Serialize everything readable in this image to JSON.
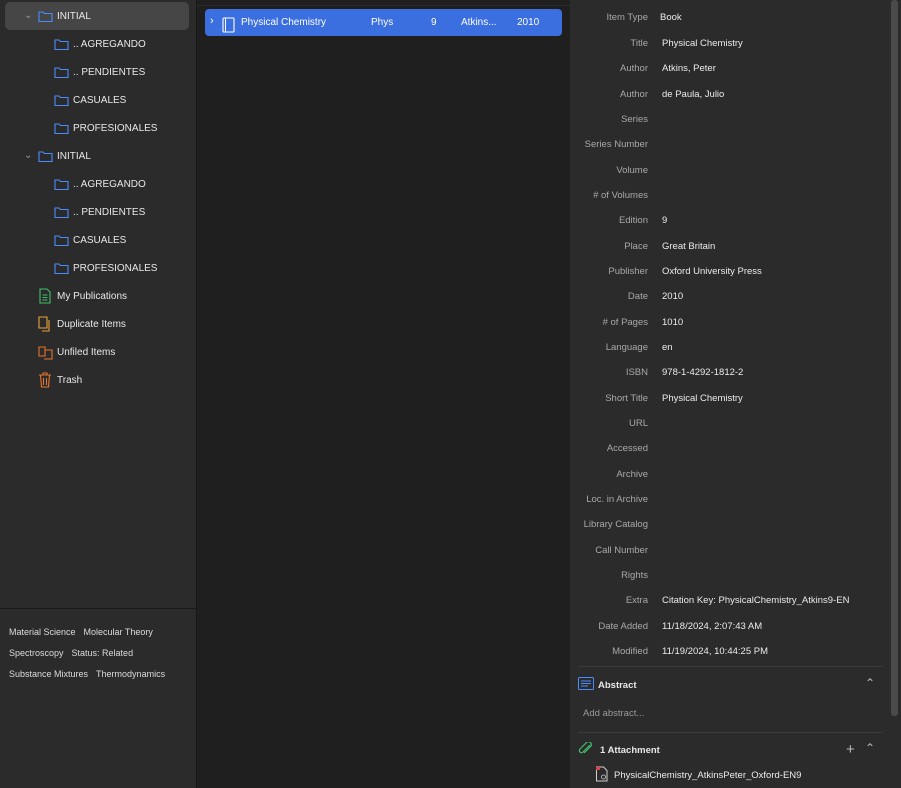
{
  "collections": {
    "items": [
      {
        "label": "INITIAL"
      },
      {
        "label": "..  AGREGANDO"
      },
      {
        "label": "..  PENDIENTES"
      },
      {
        "label": "CASUALES"
      },
      {
        "label": "PROFESIONALES"
      },
      {
        "label": "INITIAL"
      },
      {
        "label": "..  AGREGANDO"
      },
      {
        "label": "..  PENDIENTES"
      },
      {
        "label": "CASUALES"
      },
      {
        "label": "PROFESIONALES"
      },
      {
        "label": "My  Publications"
      },
      {
        "label": "Duplicate  Items"
      },
      {
        "label": "Unfiled  Items"
      },
      {
        "label": "Trash"
      }
    ]
  },
  "tags": [
    "Material  Science",
    "Molecular  Theory",
    "Spectroscopy",
    "Status:  Related",
    "Substance  Mixtures",
    "Thermodynamics"
  ],
  "item_row": {
    "title": "Physical  Chemistry",
    "short": "Phys",
    "edition": "9",
    "creator": "Atkins...",
    "year": "2010"
  },
  "info": {
    "fields": [
      {
        "label": "Item  Type",
        "value": "Book"
      },
      {
        "label": "Title",
        "value": "Physical  Chemistry"
      },
      {
        "label": "Author",
        "value": "Atkins,  Peter"
      },
      {
        "label": "Author",
        "value": "de  Paula,  Julio"
      },
      {
        "label": "Series",
        "value": ""
      },
      {
        "label": "Series  Number",
        "value": ""
      },
      {
        "label": "Volume",
        "value": ""
      },
      {
        "label": "#  of  Volumes",
        "value": ""
      },
      {
        "label": "Edition",
        "value": "9"
      },
      {
        "label": "Place",
        "value": "Great  Britain"
      },
      {
        "label": "Publisher",
        "value": "Oxford  University  Press"
      },
      {
        "label": "Date",
        "value": "2010"
      },
      {
        "label": "#  of  Pages",
        "value": "1010"
      },
      {
        "label": "Language",
        "value": "en"
      },
      {
        "label": "ISBN",
        "value": "978-1-4292-1812-2"
      },
      {
        "label": "Short  Title",
        "value": "Physical  Chemistry"
      },
      {
        "label": "URL",
        "value": ""
      },
      {
        "label": "Accessed",
        "value": ""
      },
      {
        "label": "Archive",
        "value": ""
      },
      {
        "label": "Loc.  in  Archive",
        "value": ""
      },
      {
        "label": "Library  Catalog",
        "value": ""
      },
      {
        "label": "Call  Number",
        "value": ""
      },
      {
        "label": "Rights",
        "value": ""
      },
      {
        "label": "Extra",
        "value": "Citation  Key:  PhysicalChemistry_Atkins9-EN"
      },
      {
        "label": "Date  Added",
        "value": "11/18/2024,  2:07:43  AM"
      },
      {
        "label": "Modified",
        "value": "11/19/2024,  10:44:25  PM"
      }
    ]
  },
  "abstract": {
    "title": "Abstract",
    "placeholder": "Add  abstract..."
  },
  "attachments": {
    "title": "1  Attachment",
    "file": "PhysicalChemistry_AtkinsPeter_Oxford-EN9"
  },
  "colors": {
    "accent": "#3b6fe0",
    "folder": "#4a8cff",
    "publications": "#3fbf6a",
    "duplicate": "#e8a33a",
    "unfiled": "#e8742a",
    "trash": "#e8742a"
  }
}
